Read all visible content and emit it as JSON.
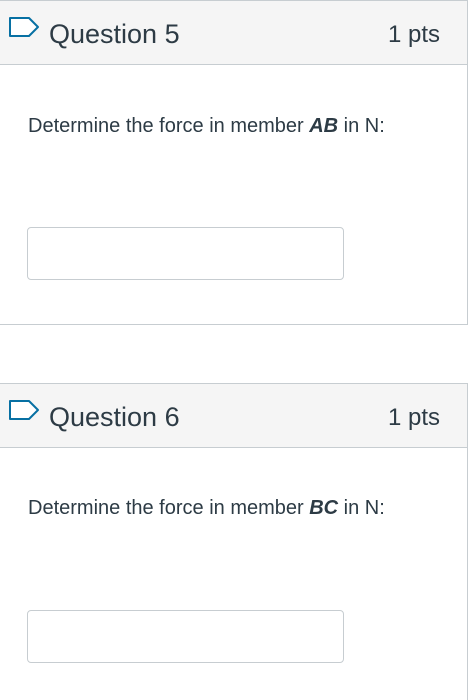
{
  "questions": [
    {
      "title": "Question 5",
      "points": "1 pts",
      "text_before": "Determine the force in member ",
      "member": "AB",
      "text_after": " in N:",
      "answer_value": ""
    },
    {
      "title": "Question 6",
      "points": "1 pts",
      "text_before": "Determine the force in member ",
      "member": "BC",
      "text_after": " in N:",
      "answer_value": ""
    }
  ],
  "icons": {
    "flag": "flag-outline-icon"
  },
  "colors": {
    "header_bg": "#f5f5f5",
    "border": "#c7cdd1",
    "text": "#2d3b45",
    "flag_outline": "#0770a3"
  }
}
